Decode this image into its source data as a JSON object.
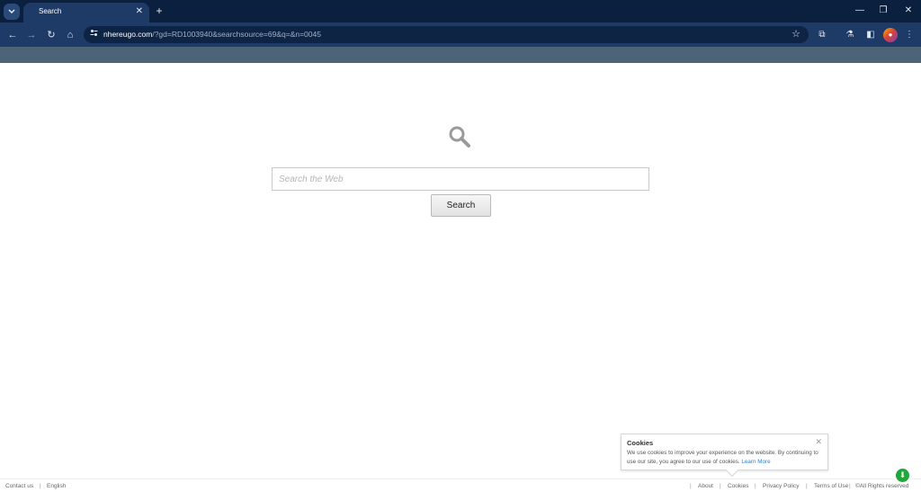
{
  "browser": {
    "tab_menu_icon": "chevron-down-icon",
    "tab": {
      "title": "Search",
      "close_glyph": "✕"
    },
    "new_tab_glyph": "+",
    "window_controls": {
      "minimize": "—",
      "restore": "❐",
      "close": "✕"
    },
    "toolbar": {
      "back": "←",
      "forward": "→",
      "reload": "↻",
      "home": "⌂",
      "url_host": "nhereugo.com",
      "url_path": "/?gd=RD1003940&searchsource=69&q=&n=0045",
      "bookmark_star": "☆",
      "extensions": "⧉",
      "labs": "⚗",
      "side_panel": "◧",
      "profile": "●",
      "menu": "⋮"
    }
  },
  "search": {
    "placeholder": "Search the Web",
    "button_label": "Search"
  },
  "cookie_notice": {
    "title": "Cookies",
    "text": "We use cookies to improve your experience on the website. By continuing to use our site, you agree to our use of cookies.",
    "link_label": "Learn More",
    "close_glyph": "✕"
  },
  "footer": {
    "contact": "Contact us",
    "language": "English",
    "about": "About",
    "cookies": "Cookies",
    "privacy": "Privacy Policy",
    "terms": "Terms of Use",
    "rights": "©All Rights reserved",
    "separator": "|"
  },
  "download_badge": "⬇",
  "colors": {
    "tabstrip": "#0b1f3f",
    "toolbar": "#1e3a66",
    "bookmark_bar": "#4d6478",
    "accent_link": "#2a7fd4",
    "download_badge": "#1fa83a"
  }
}
